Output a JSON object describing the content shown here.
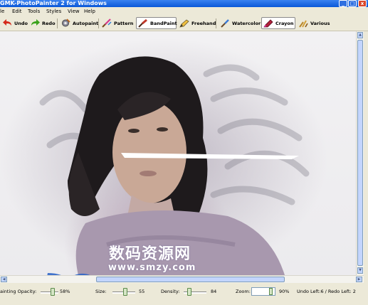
{
  "window": {
    "title": "GMK-PhotoPainter 2 for Windows",
    "buttons": {
      "minimize": "_",
      "maximize": "□",
      "close": "x"
    }
  },
  "menu": {
    "items": [
      "le",
      "Edit",
      "Tools",
      "Styles",
      "View",
      "Help"
    ]
  },
  "toolbar": {
    "undo": "Undo",
    "redo": "Redo",
    "autopaint": "Autopaint",
    "pattern": "Pattern",
    "bandpaint": "BandPaint",
    "freehand": "Freehand",
    "watercolor": "Watercolor",
    "crayon": "Crayon",
    "various": "Various",
    "active_tools": [
      "BandPaint",
      "Crayon"
    ]
  },
  "watermark": {
    "text_cn": "数码资源网",
    "url": "www.smzy.com"
  },
  "status": {
    "opacity_label": "ainting Opacity:",
    "opacity_value": "58%",
    "size_label": "Size:",
    "size_value": "55",
    "density_label": "Density:",
    "density_value": "84",
    "zoom_label": "Zoom:",
    "zoom_value": "90%",
    "undo_redo": "Undo Left:6 / Redo Left: 2"
  }
}
